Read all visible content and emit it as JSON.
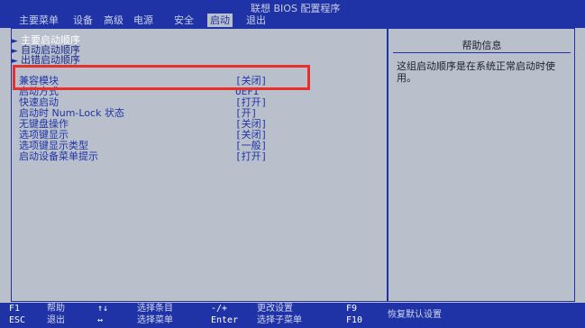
{
  "window": {
    "title": "联想 BIOS 配置程序"
  },
  "tabs": [
    {
      "label": "主要菜单"
    },
    {
      "label": "设备"
    },
    {
      "label": "高级"
    },
    {
      "label": "电源"
    },
    {
      "label": "安全"
    },
    {
      "label": "启动",
      "active": true
    },
    {
      "label": "退出"
    }
  ],
  "submenus": [
    {
      "label": "主要启动顺序",
      "highlight": true
    },
    {
      "label": "自动启动顺序"
    },
    {
      "label": "出错启动顺序"
    }
  ],
  "options": [
    {
      "label": "兼容模块",
      "value": "[关闭]"
    },
    {
      "label": "启动方式",
      "value": "UEFI"
    },
    {
      "label": "快速启动",
      "value": "[打开]"
    },
    {
      "label": "启动时 Num-Lock 状态",
      "value": "[开]"
    },
    {
      "label": "无键盘操作",
      "value": "[关闭]"
    },
    {
      "label": "选项键显示",
      "value": "[关闭]"
    },
    {
      "label": "选项键显示类型",
      "value": "[一般]"
    },
    {
      "label": "启动设备菜单提示",
      "value": "[打开]"
    }
  ],
  "help": {
    "title": "帮助信息",
    "text": "这组启动顺序是在系统正常启动时使用。"
  },
  "footer": [
    {
      "key": "F1",
      "desc": "帮助"
    },
    {
      "key": "ESC",
      "desc": "退出"
    },
    {
      "key": "↑↓",
      "desc": "选择条目"
    },
    {
      "key": "↔",
      "desc": "选择菜单"
    },
    {
      "key": "-/+",
      "desc": "更改设置"
    },
    {
      "key": "Enter",
      "desc": "选择子菜单"
    },
    {
      "key": "F9",
      "desc": "恢复默认设置"
    },
    {
      "key": "F10",
      "desc": ""
    }
  ],
  "colors": {
    "panel_bg": "#b9c0cc",
    "bios_blue": "#1f33a6",
    "highlight_border": "#e8302a"
  }
}
